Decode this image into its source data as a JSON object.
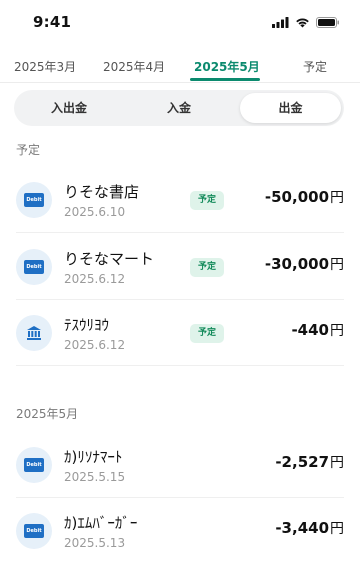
{
  "status_bar": {
    "time": "9:41"
  },
  "month_tabs": [
    "2025年3月",
    "2025年4月",
    "2025年5月",
    "予定"
  ],
  "segment": [
    "入出金",
    "入金",
    "出金"
  ],
  "sections": {
    "scheduled_label": "予定",
    "month_label": "2025年5月"
  },
  "scheduled": [
    {
      "icon": "debit-card-icon",
      "name": "りそな書店",
      "date": "2025.6.10",
      "badge": "予定",
      "amount": "-50,000",
      "currency": "円"
    },
    {
      "icon": "debit-card-icon",
      "name": "りそなマート",
      "date": "2025.6.12",
      "badge": "予定",
      "amount": "-30,000",
      "currency": "円"
    },
    {
      "icon": "bank-icon",
      "name": "ﾃｽｳﾘﾖｳ",
      "date": "2025.6.12",
      "badge": "予定",
      "amount": "-440",
      "currency": "円"
    }
  ],
  "history": [
    {
      "icon": "debit-card-icon",
      "name": "ｶ)ﾘｿﾅﾏｰﾄ",
      "date": "2025.5.15",
      "amount": "-2,527",
      "currency": "円"
    },
    {
      "icon": "debit-card-icon",
      "name": "ｶ)ｴﾑﾊﾞｰｶﾞｰ",
      "date": "2025.5.13",
      "amount": "-3,440",
      "currency": "円"
    }
  ],
  "debit_label": "Debit",
  "colors": {
    "accent": "#0b8a6e",
    "badge_bg": "#dff3ea",
    "card_blue": "#1f6fc4",
    "icon_bg": "#e6f0f9"
  }
}
